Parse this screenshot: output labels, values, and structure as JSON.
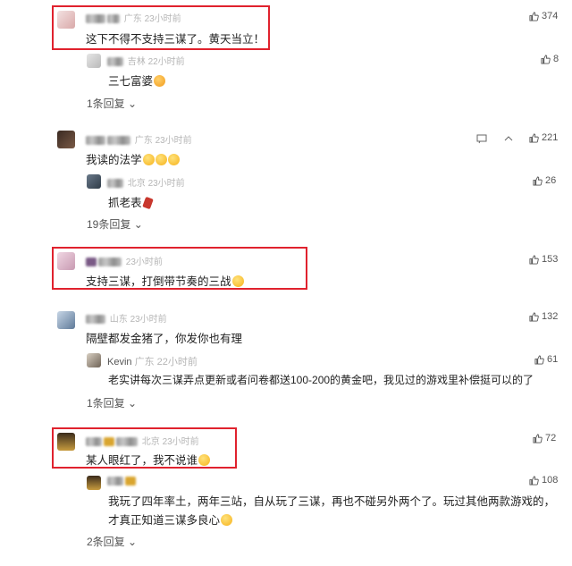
{
  "comments": [
    {
      "id": "c1",
      "location": "广东",
      "time": "23小时前",
      "text": "这下不得不支持三谋了。黄天当立！",
      "likes": "374",
      "replies_label": "1条回复",
      "reply": {
        "location": "吉林",
        "time": "22小时前",
        "text": "三七富婆",
        "likes": "8"
      }
    },
    {
      "id": "c2",
      "location": "广东",
      "time": "23小时前",
      "text": "我读的法学",
      "likes": "221",
      "replies_label": "19条回复",
      "reply": {
        "location": "北京",
        "time": "23小时前",
        "text": "抓老表",
        "likes": "26"
      }
    },
    {
      "id": "c3",
      "location": "",
      "time": "23小时前",
      "text": "支持三谋，打倒带节奏的三战",
      "likes": "153"
    },
    {
      "id": "c4",
      "location": "山东",
      "time": "23小时前",
      "text": "隔壁都发金猪了，你发你也有理",
      "likes": "132",
      "replies_label": "1条回复",
      "reply": {
        "name": "Kevin",
        "location": "广东",
        "time": "22小时前",
        "text": "老实讲每次三谋弄点更新或者问卷都送100-200的黄金吧，我见过的游戏里补偿挺可以的了",
        "likes": "61"
      }
    },
    {
      "id": "c5",
      "location": "北京",
      "time": "23小时前",
      "text": "某人眼红了，我不说谁",
      "likes": "72",
      "replies_label": "2条回复",
      "reply": {
        "location": "",
        "time": "",
        "text_line1": "我玩了四年率土，两年三站，自从玩了三谋，再也不碰另外两个了。玩过其他两款游戏的，",
        "text_line2": "才真正知道三谋多良心",
        "likes": "108"
      }
    }
  ],
  "colors": {
    "highlight": "#e0222e",
    "meta": "#b5b5b5",
    "text": "#222222"
  },
  "icons": [
    "thumb-up-icon",
    "message-icon",
    "reply-icon",
    "chevron-down-icon"
  ]
}
